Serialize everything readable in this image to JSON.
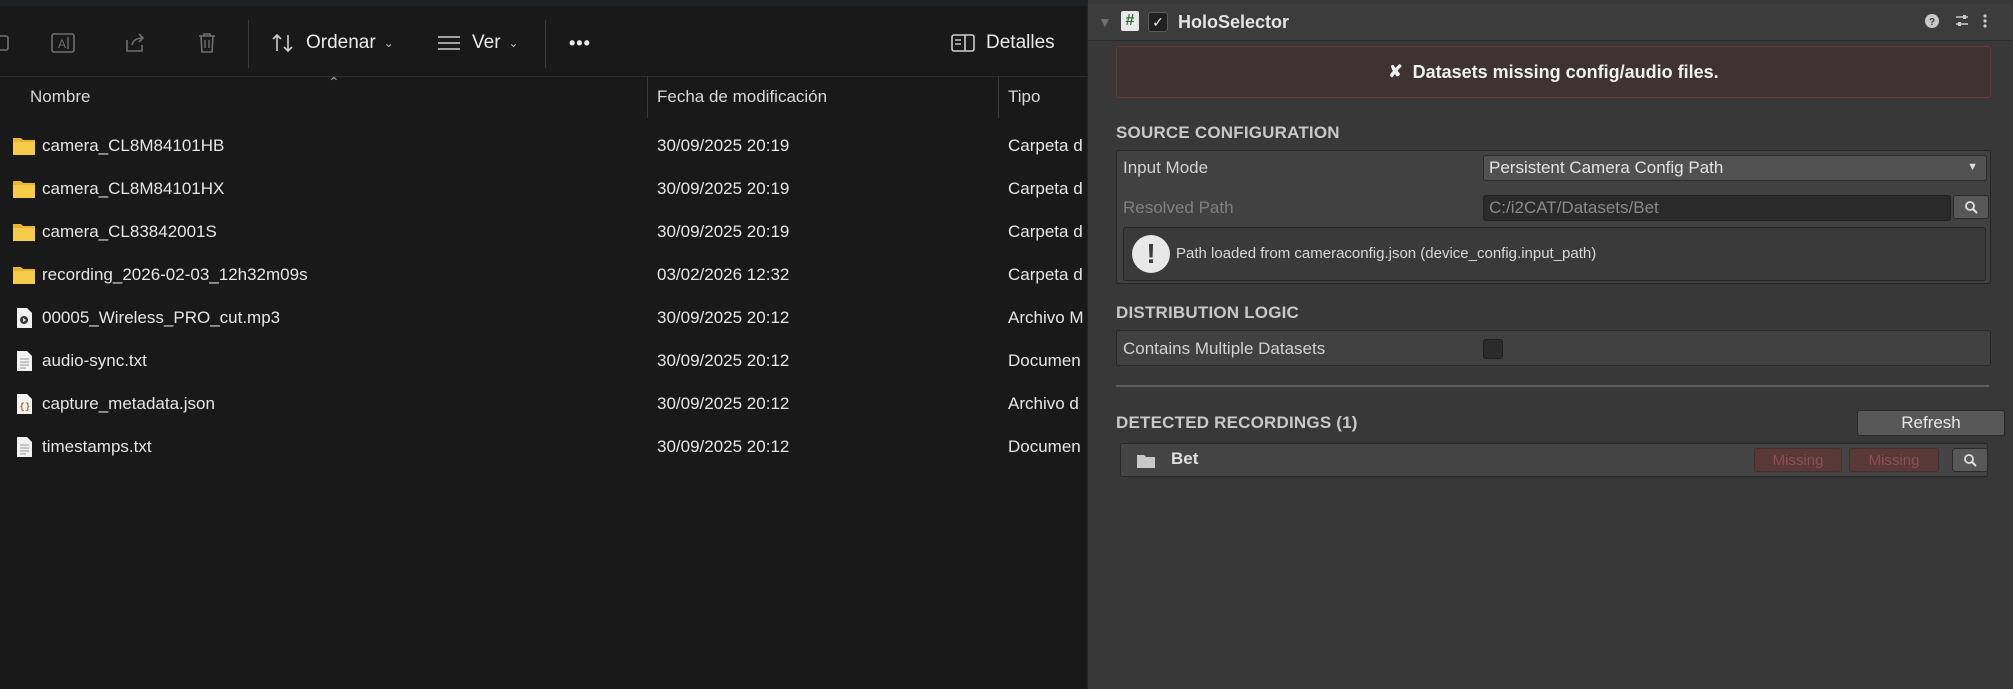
{
  "explorer": {
    "toolbar": {
      "sort_label": "Ordenar",
      "view_label": "Ver",
      "more_label": "•••",
      "details_label": "Detalles"
    },
    "columns": {
      "name": "Nombre",
      "modified": "Fecha de modificación",
      "type": "Tipo"
    },
    "files": [
      {
        "name": "camera_CL8M84101HB",
        "date": "30/09/2025 20:19",
        "type": "Carpeta d",
        "icon": "folder-icon"
      },
      {
        "name": "camera_CL8M84101HX",
        "date": "30/09/2025 20:19",
        "type": "Carpeta d",
        "icon": "folder-icon"
      },
      {
        "name": "camera_CL83842001S",
        "date": "30/09/2025 20:19",
        "type": "Carpeta d",
        "icon": "folder-icon"
      },
      {
        "name": "recording_2026-02-03_12h32m09s",
        "date": "03/02/2026 12:32",
        "type": "Carpeta d",
        "icon": "folder-icon"
      },
      {
        "name": "00005_Wireless_PRO_cut.mp3",
        "date": "30/09/2025 20:12",
        "type": "Archivo M",
        "icon": "audio-file-icon"
      },
      {
        "name": "audio-sync.txt",
        "date": "30/09/2025 20:12",
        "type": "Documen",
        "icon": "text-file-icon"
      },
      {
        "name": "capture_metadata.json",
        "date": "30/09/2025 20:12",
        "type": "Archivo d",
        "icon": "json-file-icon"
      },
      {
        "name": "timestamps.txt",
        "date": "30/09/2025 20:12",
        "type": "Documen",
        "icon": "text-file-icon"
      }
    ]
  },
  "inspector": {
    "component_title": "HoloSelector",
    "error_message": "Datasets missing config/audio files.",
    "source_section": "SOURCE CONFIGURATION",
    "input_mode_label": "Input Mode",
    "input_mode_value": "Persistent Camera Config Path",
    "resolved_path_label": "Resolved Path",
    "resolved_path_value": "C:/i2CAT/Datasets/Bet",
    "info_text": "Path loaded from cameraconfig.json (device_config.input_path)",
    "distribution_section": "DISTRIBUTION LOGIC",
    "multiple_datasets_label": "Contains Multiple Datasets",
    "multiple_datasets_checked": false,
    "detected_section": "DETECTED RECORDINGS (1)",
    "refresh_label": "Refresh",
    "recordings": [
      {
        "name": "Bet",
        "badge1": "Missing",
        "badge2": "Missing"
      }
    ],
    "colors": {
      "error_bg": "#3e3232",
      "missing_badge": "#593838",
      "folder": "#f2c232"
    }
  }
}
